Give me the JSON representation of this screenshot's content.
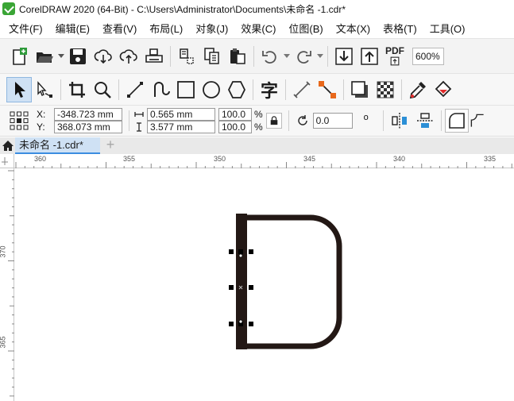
{
  "titlebar": {
    "title": "CorelDRAW 2020 (64-Bit) - C:\\Users\\Administrator\\Documents\\未命名 -1.cdr*"
  },
  "menu": [
    {
      "label": "文件(F)"
    },
    {
      "label": "编辑(E)"
    },
    {
      "label": "查看(V)"
    },
    {
      "label": "布局(L)"
    },
    {
      "label": "对象(J)"
    },
    {
      "label": "效果(C)"
    },
    {
      "label": "位图(B)"
    },
    {
      "label": "文本(X)"
    },
    {
      "label": "表格(T)"
    },
    {
      "label": "工具(O)"
    }
  ],
  "standard_toolbar": {
    "zoom_level": "600%",
    "pdf_label": "PDF"
  },
  "tools": {
    "text_tool_glyph": "字"
  },
  "property_bar": {
    "x_label": "X:",
    "y_label": "Y:",
    "x_value": "-348.723 mm",
    "y_value": "368.073 mm",
    "width_value": "0.565 mm",
    "height_value": "3.577 mm",
    "scale_x": "100.0",
    "scale_y": "100.0",
    "percent": "%",
    "rotation": "0.0",
    "degree": "o"
  },
  "tabs": {
    "document_tab": "未命名 -1.cdr*",
    "add_tab": "+"
  },
  "ruler": {
    "h_labels": [
      "360",
      "355",
      "350",
      "345",
      "340",
      "335"
    ],
    "v_labels": [
      "370",
      "365"
    ]
  },
  "colors": {
    "shape_stroke": "#231815",
    "selection": "#000000",
    "tab_active": "#cfe1f4",
    "accent": "#3c8de0"
  }
}
